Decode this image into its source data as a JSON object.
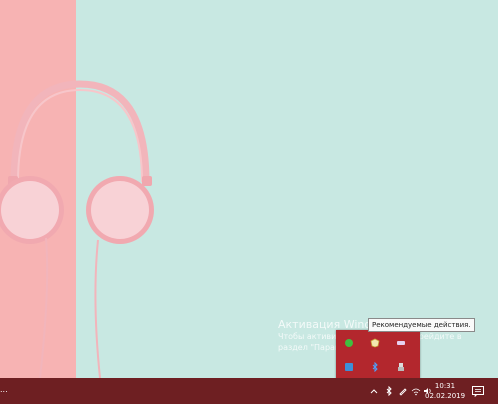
{
  "watermark": {
    "title": "Активация Windows",
    "line1": "Чтобы активировать Windows, перейдите в",
    "line2": "раздел \"Параметры\"."
  },
  "tooltip": {
    "text": "Рекомендуемые действия."
  },
  "tray_popup": {
    "icons": [
      "green-app-icon",
      "security-shield-icon",
      "pen-tablet-icon",
      "blue-app-icon",
      "bluetooth-icon",
      "usb-eject-icon"
    ]
  },
  "taskbar": {
    "left_text": "...",
    "clock": {
      "time": "10:31",
      "date": "02.02.2019"
    },
    "icons": [
      "chevron-up-icon",
      "bluetooth-icon",
      "pen-icon",
      "network-icon",
      "volume-icon",
      "notification-icon"
    ]
  },
  "colors": {
    "taskbar": "#6e1f22",
    "tray_popup": "#b3272d",
    "wall_left": "#f7b3b3",
    "wall_right": "#c8e8e2"
  }
}
